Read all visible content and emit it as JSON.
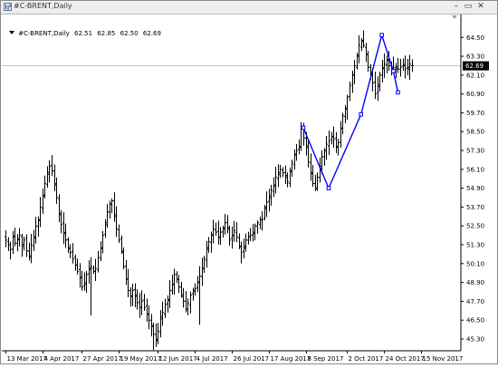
{
  "window": {
    "title": "#C-BRENT,Daily",
    "buttons": {
      "minimize": "–",
      "maximize": "▭",
      "close": "✕"
    }
  },
  "info": {
    "symbol": "#C-BRENT,Daily",
    "open": "62.51",
    "high": "62.85",
    "low": "62.50",
    "close": "62.69"
  },
  "colors": {
    "bars": "#000000",
    "zigzag": "#0000ff",
    "price_label_bg": "#000000",
    "price_label_text": "#ffffff",
    "bid_line": "#b0b0b0"
  },
  "chart_data": {
    "type": "ohlc",
    "timeframe": "Daily",
    "current_price": 62.69,
    "current_price_label": "62.69",
    "ylim": [
      44.55,
      65.9
    ],
    "y_ticks": [
      "64.50",
      "63.30",
      "62.10",
      "60.90",
      "59.70",
      "58.50",
      "57.30",
      "56.10",
      "54.90",
      "53.70",
      "52.50",
      "51.30",
      "50.10",
      "48.90",
      "47.70",
      "46.50",
      "45.30"
    ],
    "x_ticks": [
      "13 Mar 2017",
      "4 Apr 2017",
      "27 Apr 2017",
      "19 May 2017",
      "12 Jun 2017",
      "4 Jul 2017",
      "26 Jul 2017",
      "17 Aug 2017",
      "8 Sep 2017",
      "2 Oct 2017",
      "24 Oct 2017",
      "15 Nov 2017"
    ],
    "x_tick_bar_index": [
      0,
      16,
      33,
      49,
      66,
      82,
      98,
      114,
      130,
      148,
      164,
      180
    ],
    "closes": [
      51.6,
      51.3,
      51.0,
      51.8,
      51.4,
      51.7,
      51.9,
      51.2,
      51.6,
      50.9,
      50.6,
      51.3,
      51.8,
      52.5,
      52.9,
      53.7,
      54.4,
      55.2,
      55.9,
      56.3,
      56.0,
      55.1,
      54.3,
      53.3,
      52.6,
      52.0,
      51.6,
      51.1,
      50.8,
      50.4,
      50.0,
      49.6,
      49.2,
      48.6,
      48.9,
      49.4,
      49.8,
      49.9,
      49.6,
      49.8,
      50.5,
      51.1,
      51.9,
      52.7,
      53.4,
      53.9,
      54.1,
      53.1,
      52.3,
      51.6,
      50.9,
      49.9,
      49.1,
      48.4,
      48.0,
      48.4,
      48.0,
      47.6,
      47.3,
      47.7,
      47.3,
      46.9,
      46.5,
      46.1,
      45.6,
      45.3,
      45.8,
      46.7,
      47.0,
      47.5,
      47.8,
      48.4,
      48.8,
      49.4,
      49.1,
      48.6,
      48.1,
      47.7,
      47.2,
      47.6,
      48.1,
      48.4,
      48.5,
      48.9,
      49.3,
      49.8,
      50.4,
      51.0,
      51.5,
      51.9,
      52.3,
      52.1,
      51.8,
      52.1,
      52.3,
      52.7,
      52.4,
      51.6,
      51.9,
      52.2,
      51.8,
      51.2,
      50.8,
      51.2,
      51.6,
      51.8,
      51.9,
      52.1,
      52.5,
      52.7,
      52.9,
      52.9,
      53.6,
      54.0,
      54.4,
      54.8,
      55.1,
      55.6,
      55.9,
      56.1,
      55.9,
      55.6,
      55.3,
      56.0,
      56.5,
      57.0,
      57.3,
      57.5,
      58.7,
      58.1,
      57.6,
      56.6,
      55.9,
      55.2,
      54.9,
      55.6,
      56.3,
      56.9,
      57.3,
      57.7,
      57.9,
      58.2,
      58.0,
      57.5,
      57.8,
      58.7,
      59.5,
      60.0,
      60.7,
      61.4,
      62.1,
      62.7,
      63.3,
      64.0,
      64.3,
      64.0,
      63.4,
      62.6,
      62.2,
      61.6,
      60.9,
      61.5,
      62.1,
      62.5,
      62.8,
      63.1,
      62.7,
      62.4,
      62.6,
      62.5,
      62.5,
      62.6,
      62.7,
      62.5,
      62.6,
      62.8,
      62.7
    ],
    "zigzag": [
      {
        "x_index": 129,
        "price": 58.75
      },
      {
        "x_index": 140,
        "price": 54.9
      },
      {
        "x_index": 154,
        "price": 59.6
      },
      {
        "x_index": 163,
        "price": 64.65
      },
      {
        "x_index": 168,
        "price": 62.35
      },
      {
        "x_index": 170,
        "price": 61.0
      }
    ],
    "grid": false
  }
}
